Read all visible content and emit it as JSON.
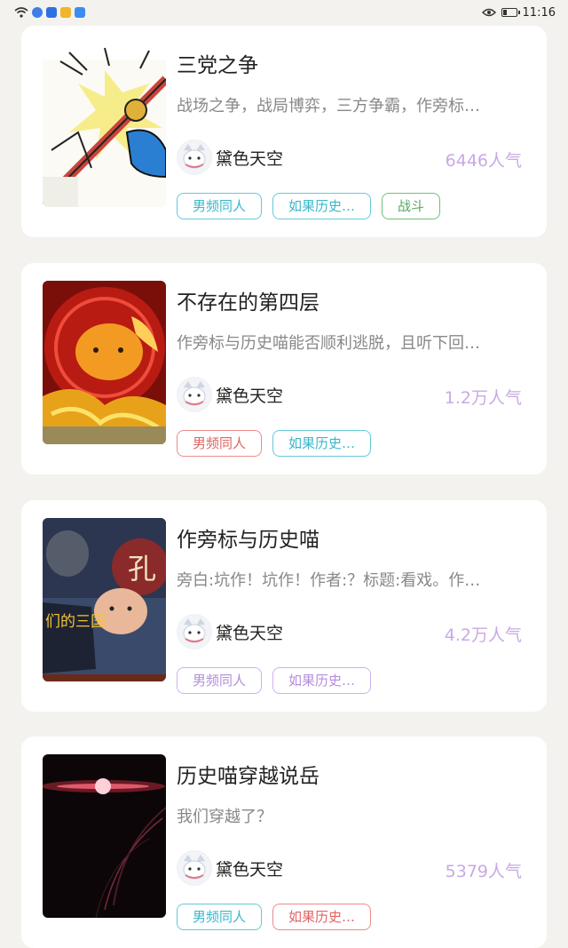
{
  "status_bar": {
    "time": "11:16",
    "icons": [
      "wifi-icon",
      "signal-icon",
      "app-icon",
      "app-icon",
      "app-icon",
      "eye-icon",
      "battery-icon"
    ]
  },
  "works": [
    {
      "title": "三党之争",
      "desc": "战场之争，战局博弈，三方争霸，作旁标…",
      "author": "黛色天空",
      "popularity": "6446人气",
      "tags": [
        "男频同人",
        "如果历史…",
        "战斗"
      ]
    },
    {
      "title": "不存在的第四层",
      "desc": "作旁标与历史喵能否顺利逃脱，且听下回…",
      "author": "黛色天空",
      "popularity": "1.2万人气",
      "tags": [
        "男频同人",
        "如果历史…"
      ]
    },
    {
      "title": "作旁标与历史喵",
      "desc": "旁白:坑作！坑作！作者:？标题:看戏。作…",
      "author": "黛色天空",
      "popularity": "4.2万人气",
      "tags": [
        "男频同人",
        "如果历史…"
      ]
    },
    {
      "title": "历史喵穿越说岳",
      "desc": "我们穿越了？",
      "author": "黛色天空",
      "popularity": "5379人气",
      "tags": [
        "男频同人",
        "如果历史…"
      ]
    }
  ],
  "cover_text": {
    "card3": "们的三国",
    "card3_sign": "孔"
  }
}
